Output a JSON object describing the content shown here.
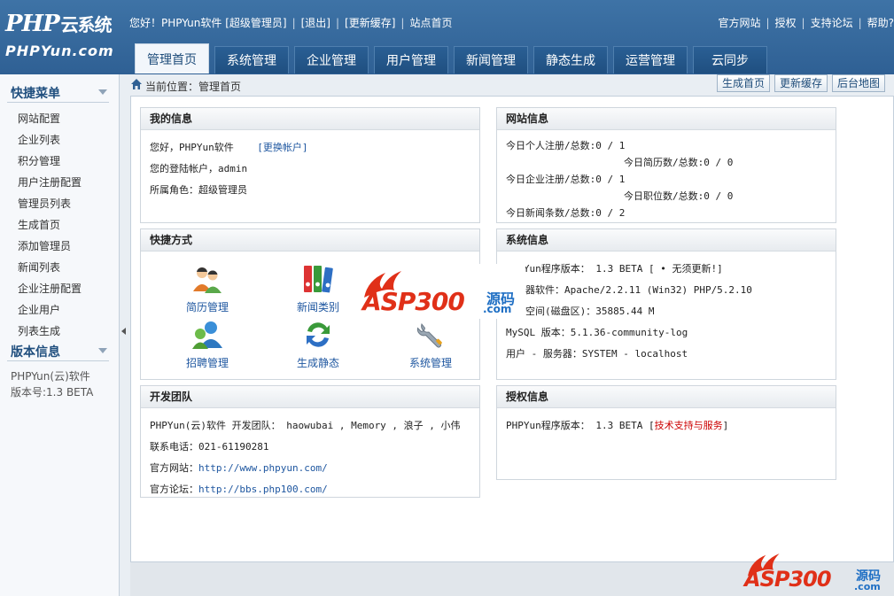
{
  "header": {
    "logo_top": "PHP",
    "logo_top_cn": "云系统",
    "logo_bottom": "PHPYun.com",
    "greeting": "您好！PHPYun软件 [超级管理员]",
    "logout": "[退出]",
    "refresh_cache": "[更新缓存]",
    "site_home": "站点首页",
    "official_site": "官方网站",
    "license": "授权",
    "forum": "支持论坛",
    "help": "帮助?"
  },
  "nav": {
    "tabs": [
      {
        "label": "管理首页",
        "active": true
      },
      {
        "label": "系统管理"
      },
      {
        "label": "企业管理"
      },
      {
        "label": "用户管理"
      },
      {
        "label": "新闻管理"
      },
      {
        "label": "静态生成"
      },
      {
        "label": "运营管理"
      },
      {
        "label": "云同步"
      }
    ]
  },
  "sidebar": {
    "quick_menu_title": "快捷菜单",
    "items": [
      {
        "label": "网站配置"
      },
      {
        "label": "企业列表"
      },
      {
        "label": "积分管理"
      },
      {
        "label": "用户注册配置"
      },
      {
        "label": "管理员列表"
      },
      {
        "label": "生成首页"
      },
      {
        "label": "添加管理员"
      },
      {
        "label": "新闻列表"
      },
      {
        "label": "企业注册配置"
      },
      {
        "label": "企业用户"
      },
      {
        "label": "列表生成"
      }
    ],
    "version_title": "版本信息",
    "version_name": "PHPYun(云)软件",
    "version_number": "版本号:1.3 BETA"
  },
  "breadcrumb": {
    "text": "当前位置：管理首页",
    "btn_gen_home": "生成首页",
    "btn_update_cache": "更新缓存",
    "btn_sitemap": "后台地图"
  },
  "my_info": {
    "title": "我的信息",
    "hello": "您好，PHPYun软件",
    "switch_account": "[更换帐户]",
    "login_account": "您的登陆帐户，admin",
    "role": "所属角色：超级管理员"
  },
  "site_info": {
    "title": "网站信息",
    "rows": [
      "今日个人注册/总数:0 / 1",
      "今日简历数/总数:0 / 0",
      "今日企业注册/总数:0 / 1",
      "今日职位数/总数:0 / 0",
      "今日新闻条数/总数:0 / 2"
    ]
  },
  "shortcuts": {
    "title": "快捷方式",
    "items": [
      {
        "label": "简历管理",
        "icon": "users-icon"
      },
      {
        "label": "新闻类别",
        "icon": "binders-icon"
      },
      {
        "label": "招聘管理",
        "icon": "recruit-icon"
      },
      {
        "label": "生成静态",
        "icon": "refresh-icon"
      },
      {
        "label": "系统管理",
        "icon": "wrench-icon"
      }
    ]
  },
  "system_info": {
    "title": "系统信息",
    "program_version": "PHPYun程序版本： 1.3 BETA [ ",
    "no_update": "• 无须更新!]",
    "server_software": "服务器软件：Apache/2.2.11 (Win32) PHP/5.2.10",
    "disk_space": "可用空间(磁盘区)：35885.44 M",
    "mysql_version": "MySQL 版本：5.1.36-community-log",
    "user_server": "用户 - 服务器：SYSTEM - localhost"
  },
  "dev_team": {
    "title": "开发团队",
    "team": "PHPYun(云)软件 开发团队： haowubai , Memory , 浪子 , 小伟",
    "phone": "联系电话：021-61190281",
    "website_label": "官方网站：",
    "website_url": "http://www.phpyun.com/",
    "forum_label": "官方论坛：",
    "forum_url": "http://bbs.php100.com/"
  },
  "license_info": {
    "title": "授权信息",
    "version": "PHPYun程序版本： 1.3 BETA [",
    "support": "技术支持与服务",
    "close": "]"
  },
  "watermark": {
    "brand": "ASP300",
    "cn": "源码",
    "domain": ".com"
  },
  "colors": {
    "header_blue": "#2f6094",
    "link_blue": "#1f57a0",
    "red": "#cc0000",
    "watermark_red": "#e03018",
    "watermark_blue": "#1f6fc4"
  }
}
